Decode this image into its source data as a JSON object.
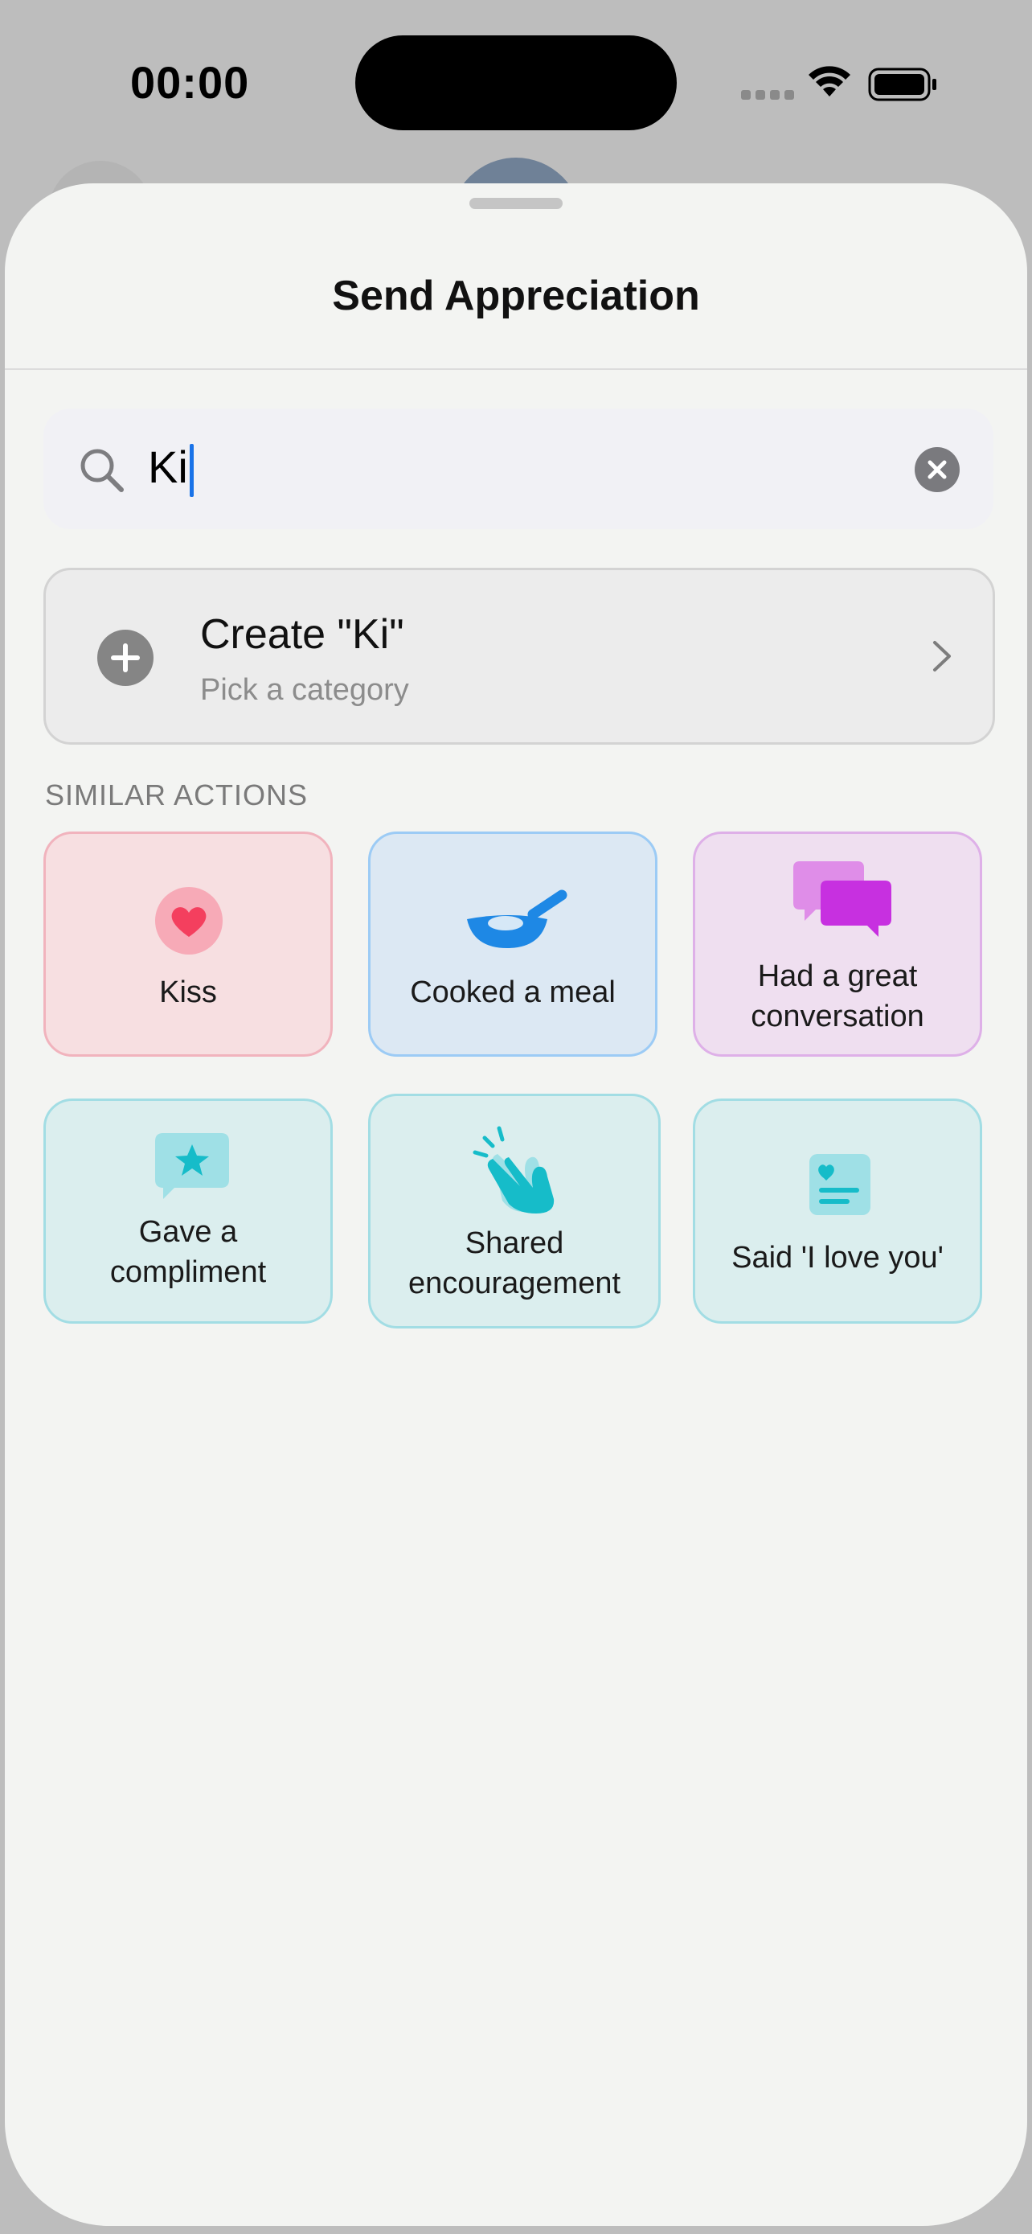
{
  "status_bar": {
    "time": "00:00"
  },
  "sheet": {
    "title": "Send Appreciation"
  },
  "search": {
    "value": "Ki",
    "clear_icon": "xmark-circle-icon",
    "search_icon": "magnifier-icon"
  },
  "create": {
    "title": "Create \"Ki\"",
    "subtitle": "Pick a category",
    "icon": "plus-circle-icon"
  },
  "similar": {
    "header": "SIMILAR ACTIONS",
    "items": [
      {
        "label": "Kiss",
        "icon": "heart-icon",
        "color": "#f43f5e"
      },
      {
        "label": "Cooked a meal",
        "icon": "frying-pan-icon",
        "color": "#1e88e5"
      },
      {
        "label": "Had a great conversation",
        "icon": "speech-bubbles-icon",
        "color": "#c730e0"
      },
      {
        "label": "Gave a compliment",
        "icon": "star-bubble-icon",
        "color": "#16bcc9"
      },
      {
        "label": "Shared encouragement",
        "icon": "clapping-hands-icon",
        "color": "#16bcc9"
      },
      {
        "label": "Said 'I love you'",
        "icon": "love-note-icon",
        "color": "#16bcc9"
      }
    ]
  }
}
